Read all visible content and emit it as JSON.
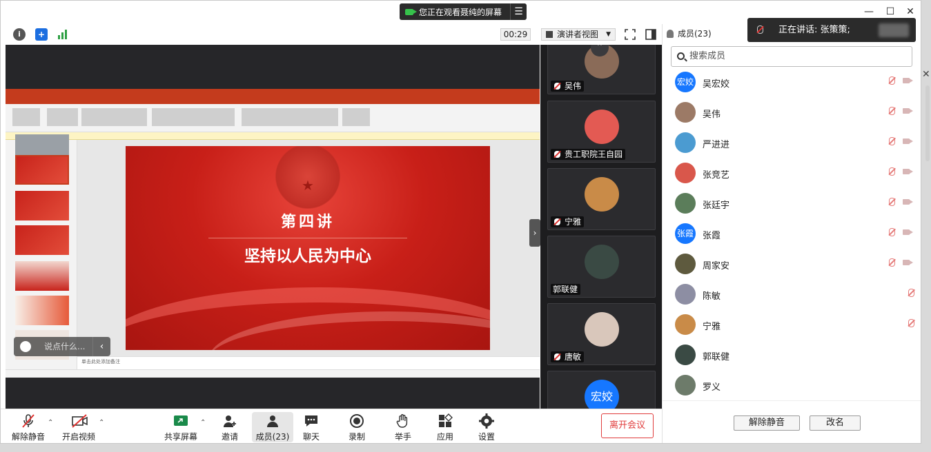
{
  "window": {
    "share_banner": "您正在观看聂纯的屏幕",
    "share_menu_icon": "menu-lines-icon"
  },
  "toolbar": {
    "timer": "00:29",
    "view_mode": "演讲者视图",
    "members_tab": "成员(23)"
  },
  "presentation": {
    "lecture": "第四讲",
    "title": "坚持以人民为中心",
    "notes_hint": "单击此处添加备注"
  },
  "comment": {
    "placeholder": "说点什么..."
  },
  "gallery": [
    {
      "name": "吴伟",
      "muted": true,
      "color": "#8a6b58"
    },
    {
      "name": "贵工职院王自园",
      "muted": true,
      "color": "#e35a53"
    },
    {
      "name": "宁雅",
      "muted": true,
      "color": "#c98b48"
    },
    {
      "name": "郭联健",
      "muted": false,
      "color": "#3a4a44"
    },
    {
      "name": "唐敏",
      "muted": true,
      "color": "#d9c7bb"
    },
    {
      "name": "宏姣",
      "muted": false,
      "color": "#1677ff",
      "avatar_text": "宏姣"
    }
  ],
  "speaking": {
    "label": "正在讲话: 张策策;"
  },
  "panel": {
    "title": "成员(23)",
    "search_placeholder": "搜索成员",
    "members": [
      {
        "name": "吴宏姣",
        "avatar_text": "宏姣",
        "color": "#1677ff",
        "mic": "muted",
        "video": true
      },
      {
        "name": "吴伟",
        "avatar_text": "",
        "color": "#9c7a66",
        "mic": "muted",
        "video": true
      },
      {
        "name": "严进进",
        "avatar_text": "",
        "color": "#4b9bd1",
        "mic": "muted",
        "video": true
      },
      {
        "name": "张竞艺",
        "avatar_text": "",
        "color": "#d9574b",
        "mic": "muted",
        "video": true
      },
      {
        "name": "张廷宇",
        "avatar_text": "",
        "color": "#5b7d5a",
        "mic": "muted",
        "video": true
      },
      {
        "name": "张霞",
        "avatar_text": "张霞",
        "color": "#1677ff",
        "mic": "muted",
        "video": true
      },
      {
        "name": "周家安",
        "avatar_text": "",
        "color": "#5e5a3e",
        "mic": "muted",
        "video": true
      },
      {
        "name": "陈敏",
        "avatar_text": "",
        "color": "#8d8ea3",
        "mic": "muted",
        "video": false
      },
      {
        "name": "宁雅",
        "avatar_text": "",
        "color": "#c98b48",
        "mic": "muted",
        "video": false
      },
      {
        "name": "郭联健",
        "avatar_text": "",
        "color": "#3a4a44",
        "mic": "none",
        "video": false
      },
      {
        "name": "罗义",
        "avatar_text": "",
        "color": "#6d7b6a",
        "mic": "none",
        "video": false
      }
    ],
    "unmute_all": "解除静音",
    "rename": "改名"
  },
  "bottom": {
    "unmute": "解除静音",
    "start_video": "开启视频",
    "share": "共享屏幕",
    "invite": "邀请",
    "members": "成员(23)",
    "chat": "聊天",
    "record": "录制",
    "raise_hand": "举手",
    "apps": "应用",
    "settings": "设置",
    "leave": "离开会议"
  }
}
